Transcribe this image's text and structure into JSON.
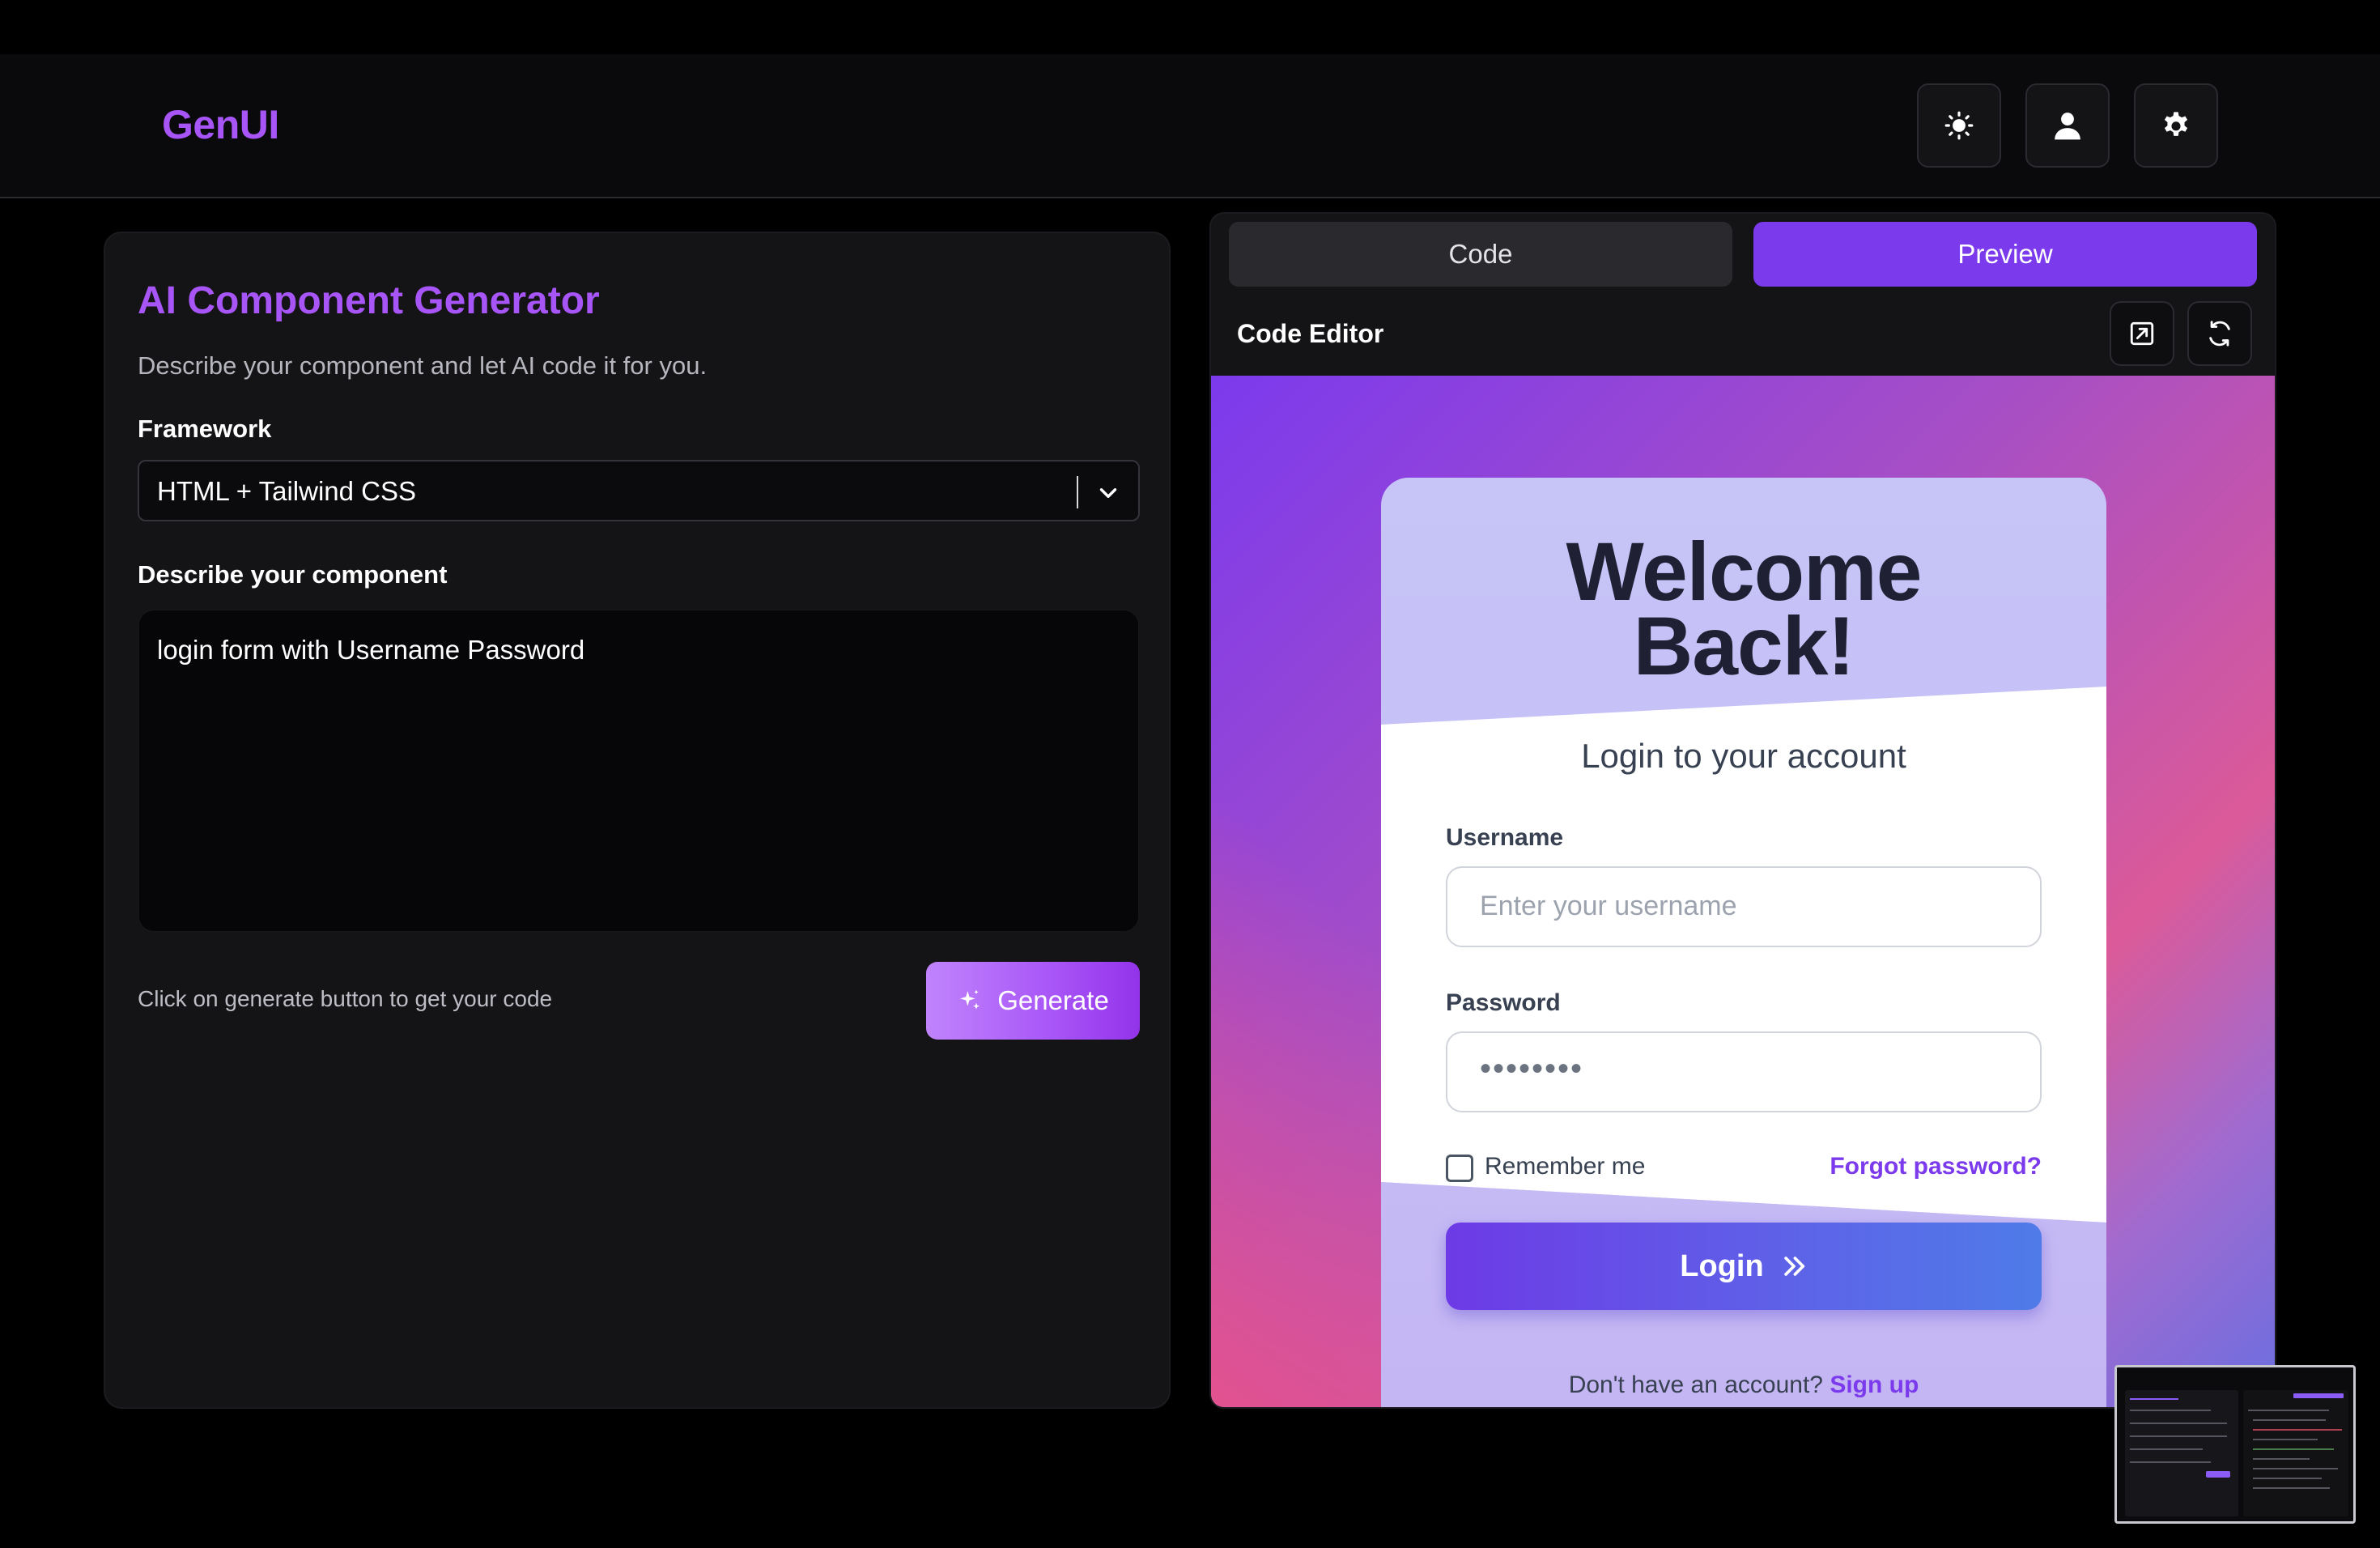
{
  "header": {
    "logo": "GenUI",
    "buttons": [
      {
        "name": "theme-toggle",
        "icon": "sun-icon"
      },
      {
        "name": "profile",
        "icon": "user-icon"
      },
      {
        "name": "settings",
        "icon": "gear-icon"
      }
    ]
  },
  "generator": {
    "title": "AI Component Generator",
    "description": "Describe your component and let AI code it for you.",
    "framework_label": "Framework",
    "framework_value": "HTML + Tailwind CSS",
    "describe_label": "Describe your component",
    "prompt_value": "login form with Username Password",
    "hint": "Click on generate button to get your code",
    "generate_label": "Generate"
  },
  "editor": {
    "tabs": [
      {
        "label": "Code",
        "active": false
      },
      {
        "label": "Preview",
        "active": true
      }
    ],
    "title": "Code Editor",
    "icons": [
      "open-external-icon",
      "refresh-icon"
    ]
  },
  "preview": {
    "heading_line1": "Welcome",
    "heading_line2": "Back!",
    "subtitle": "Login to your account",
    "username_label": "Username",
    "username_placeholder": "Enter your username",
    "password_label": "Password",
    "password_value": "••••••••",
    "remember_label": "Remember me",
    "forgot_label": "Forgot password?",
    "login_label": "Login",
    "signup_prompt": "Don't have an account?",
    "signup_link": "Sign up"
  },
  "colors": {
    "accent": "#a855f7",
    "preview_tab": "#7c3aed",
    "background": "#000000",
    "panel": "#141417"
  }
}
